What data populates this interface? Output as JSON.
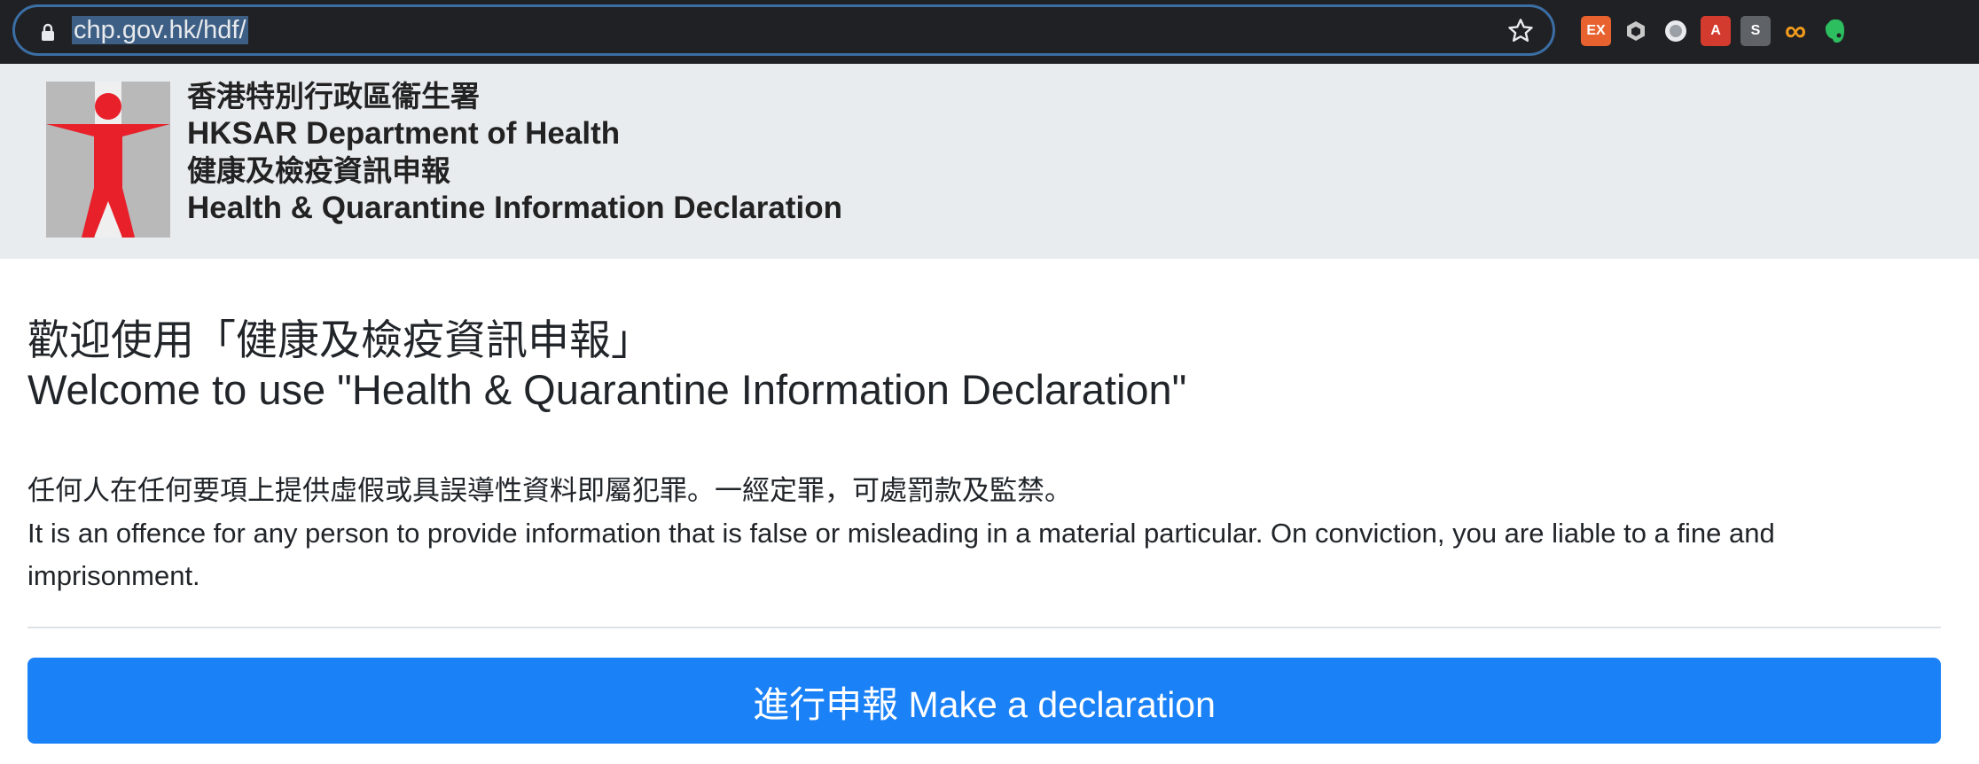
{
  "browser": {
    "url_prefix": "",
    "url_selected": "chp.gov.hk/hdf/",
    "extensions": [
      {
        "name": "ex-extension-icon",
        "label": "EX",
        "bg": "#e8622f",
        "fg": "#ffffff"
      },
      {
        "name": "cube-extension-icon",
        "label": "",
        "bg": "transparent",
        "fg": "#c8c8c8"
      },
      {
        "name": "circle-extension-icon",
        "label": "",
        "bg": "transparent",
        "fg": "#e8eaed"
      },
      {
        "name": "pdf-extension-icon",
        "label": "A",
        "bg": "#d33b2f",
        "fg": "#ffffff"
      },
      {
        "name": "s-extension-icon",
        "label": "S",
        "bg": "#5f6368",
        "fg": "#ffffff"
      },
      {
        "name": "infinity-extension-icon",
        "label": "∞",
        "bg": "transparent",
        "fg": "#f29b1d"
      },
      {
        "name": "evernote-extension-icon",
        "label": "",
        "bg": "transparent",
        "fg": "#2dbe60"
      }
    ]
  },
  "header": {
    "dept_zh": "香港特別行政區衞生署",
    "dept_en": "HKSAR Department of Health",
    "form_zh": "健康及檢疫資訊申報",
    "form_en": "Health & Quarantine Information Declaration"
  },
  "main": {
    "welcome_zh": "歡迎使用「健康及檢疫資訊申報」",
    "welcome_en": "Welcome to use \"Health & Quarantine Information Declaration\"",
    "notice_zh": "任何人在任何要項上提供虛假或具誤導性資料即屬犯罪。一經定罪，可處罰款及監禁。",
    "notice_en": "It is an offence for any person to provide information that is false or misleading in a material particular. On conviction, you are liable to a fine and imprisonment.",
    "declare_button": "進行申報 Make a declaration"
  },
  "colors": {
    "primary_button": "#1a81f7",
    "header_bg": "#e9ecef",
    "logo_red": "#e8202a",
    "logo_grey": "#b9b9b9"
  }
}
